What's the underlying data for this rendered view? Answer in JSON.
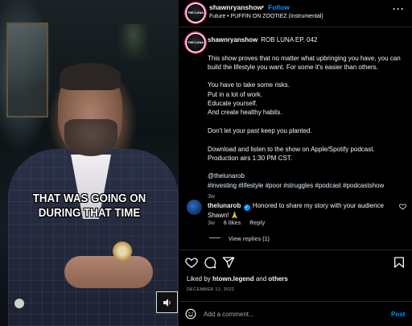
{
  "video": {
    "caption_line1": "THAT WAS GOING ON",
    "caption_line2": "DURING THAT TIME"
  },
  "header": {
    "avatar_text": "THE LUNA",
    "username": "shawnryanshow",
    "separator": "•",
    "follow_label": "Follow",
    "audio_label": "Future • PUFFIN ON ZOOTIEZ (Instrumental)",
    "more_label": "···"
  },
  "caption": {
    "avatar_text": "THE LUNA",
    "username": "shawnryanshow",
    "title": "ROB LUNA EP. 042",
    "p1": "This show proves that no matter what upbringing you have, you can build the lifestyle you want. For some it's easier than others.",
    "p2_lines": [
      "You have to take some risks.",
      "Put in a lot of work.",
      "Educate yourself.",
      "And create healthy habits."
    ],
    "p3": "Don't let your past keep you planted.",
    "p4_lines": [
      "Download and listen to the show on Apple/Spotify podcast.",
      "Production airs 1:30 PM CST."
    ],
    "mention": "@thelunarob",
    "hashtags": "#investing #lifestyle #poor #struggles #podcast #podcastshow",
    "age": "3w"
  },
  "comment": {
    "username": "thelunarob",
    "text": "Honored to share my story with your audience Shawn! 🙏",
    "age": "3w",
    "likes": "6 likes",
    "reply_label": "Reply",
    "view_replies": "View replies (1)"
  },
  "actions": {
    "liked_by_prefix": "Liked by ",
    "liked_by_user": "htown.legend",
    "liked_by_suffix": " and ",
    "liked_by_others": "others",
    "date": "DECEMBER 12, 2022"
  },
  "composer": {
    "placeholder": "Add a comment...",
    "post_label": "Post"
  },
  "colors": {
    "background": "#000000",
    "link_blue": "#0095f6",
    "muted": "#a8a8a8",
    "text": "#f5f5f5"
  },
  "icons": [
    "more-icon",
    "heart-icon",
    "comment-icon",
    "share-icon",
    "bookmark-icon",
    "emoji-icon",
    "verified-icon",
    "sound-icon"
  ]
}
